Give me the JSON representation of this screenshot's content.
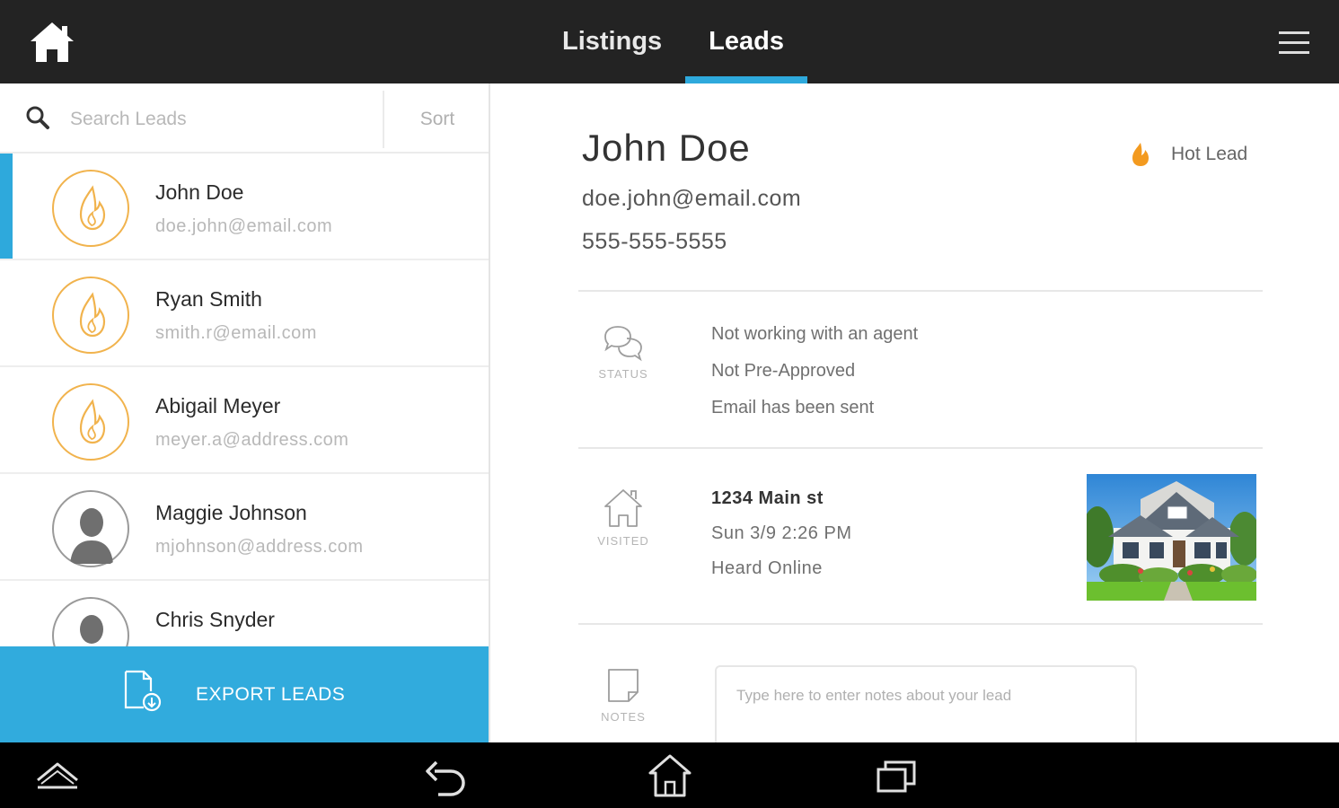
{
  "topbar": {
    "home_icon": "home-icon",
    "tabs": [
      {
        "label": "Listings",
        "active": false
      },
      {
        "label": "Leads",
        "active": true
      }
    ],
    "menu_icon": "hamburger-menu-icon",
    "accent_color": "#2ea9dc"
  },
  "search": {
    "placeholder": "Search Leads",
    "sort_label": "Sort"
  },
  "leads": [
    {
      "name": "John Doe",
      "email": "doe.john@email.com",
      "avatar": "flame-icon",
      "selected": true
    },
    {
      "name": "Ryan Smith",
      "email": "smith.r@email.com",
      "avatar": "flame-icon",
      "selected": false
    },
    {
      "name": "Abigail Meyer",
      "email": "meyer.a@address.com",
      "avatar": "flame-icon",
      "selected": false
    },
    {
      "name": "Maggie Johnson",
      "email": "mjohnson@address.com",
      "avatar": "person-icon",
      "selected": false
    },
    {
      "name": "Chris Snyder",
      "email": "",
      "avatar": "person-icon",
      "selected": false
    }
  ],
  "export": {
    "label": "EXPORT LEADS",
    "icon": "export-file-icon",
    "color": "#31abdd"
  },
  "detail": {
    "name": "John Doe",
    "email": "doe.john@email.com",
    "phone": "555-555-5555",
    "badge_label": "Hot Lead",
    "badge_icon": "flame-icon",
    "status": {
      "caption": "STATUS",
      "lines": [
        "Not working with an agent",
        "Not Pre-Approved",
        "Email has been sent"
      ]
    },
    "visited": {
      "caption": "VISITED",
      "address": "1234 Main st",
      "datetime": "Sun 3/9 2:26 PM",
      "source": "Heard Online"
    },
    "notes": {
      "caption": "NOTES",
      "placeholder": "Type here to enter notes about your lead"
    }
  },
  "android_nav": [
    "up-chevron-icon",
    "back-icon",
    "home-outline-icon",
    "recent-apps-icon"
  ]
}
